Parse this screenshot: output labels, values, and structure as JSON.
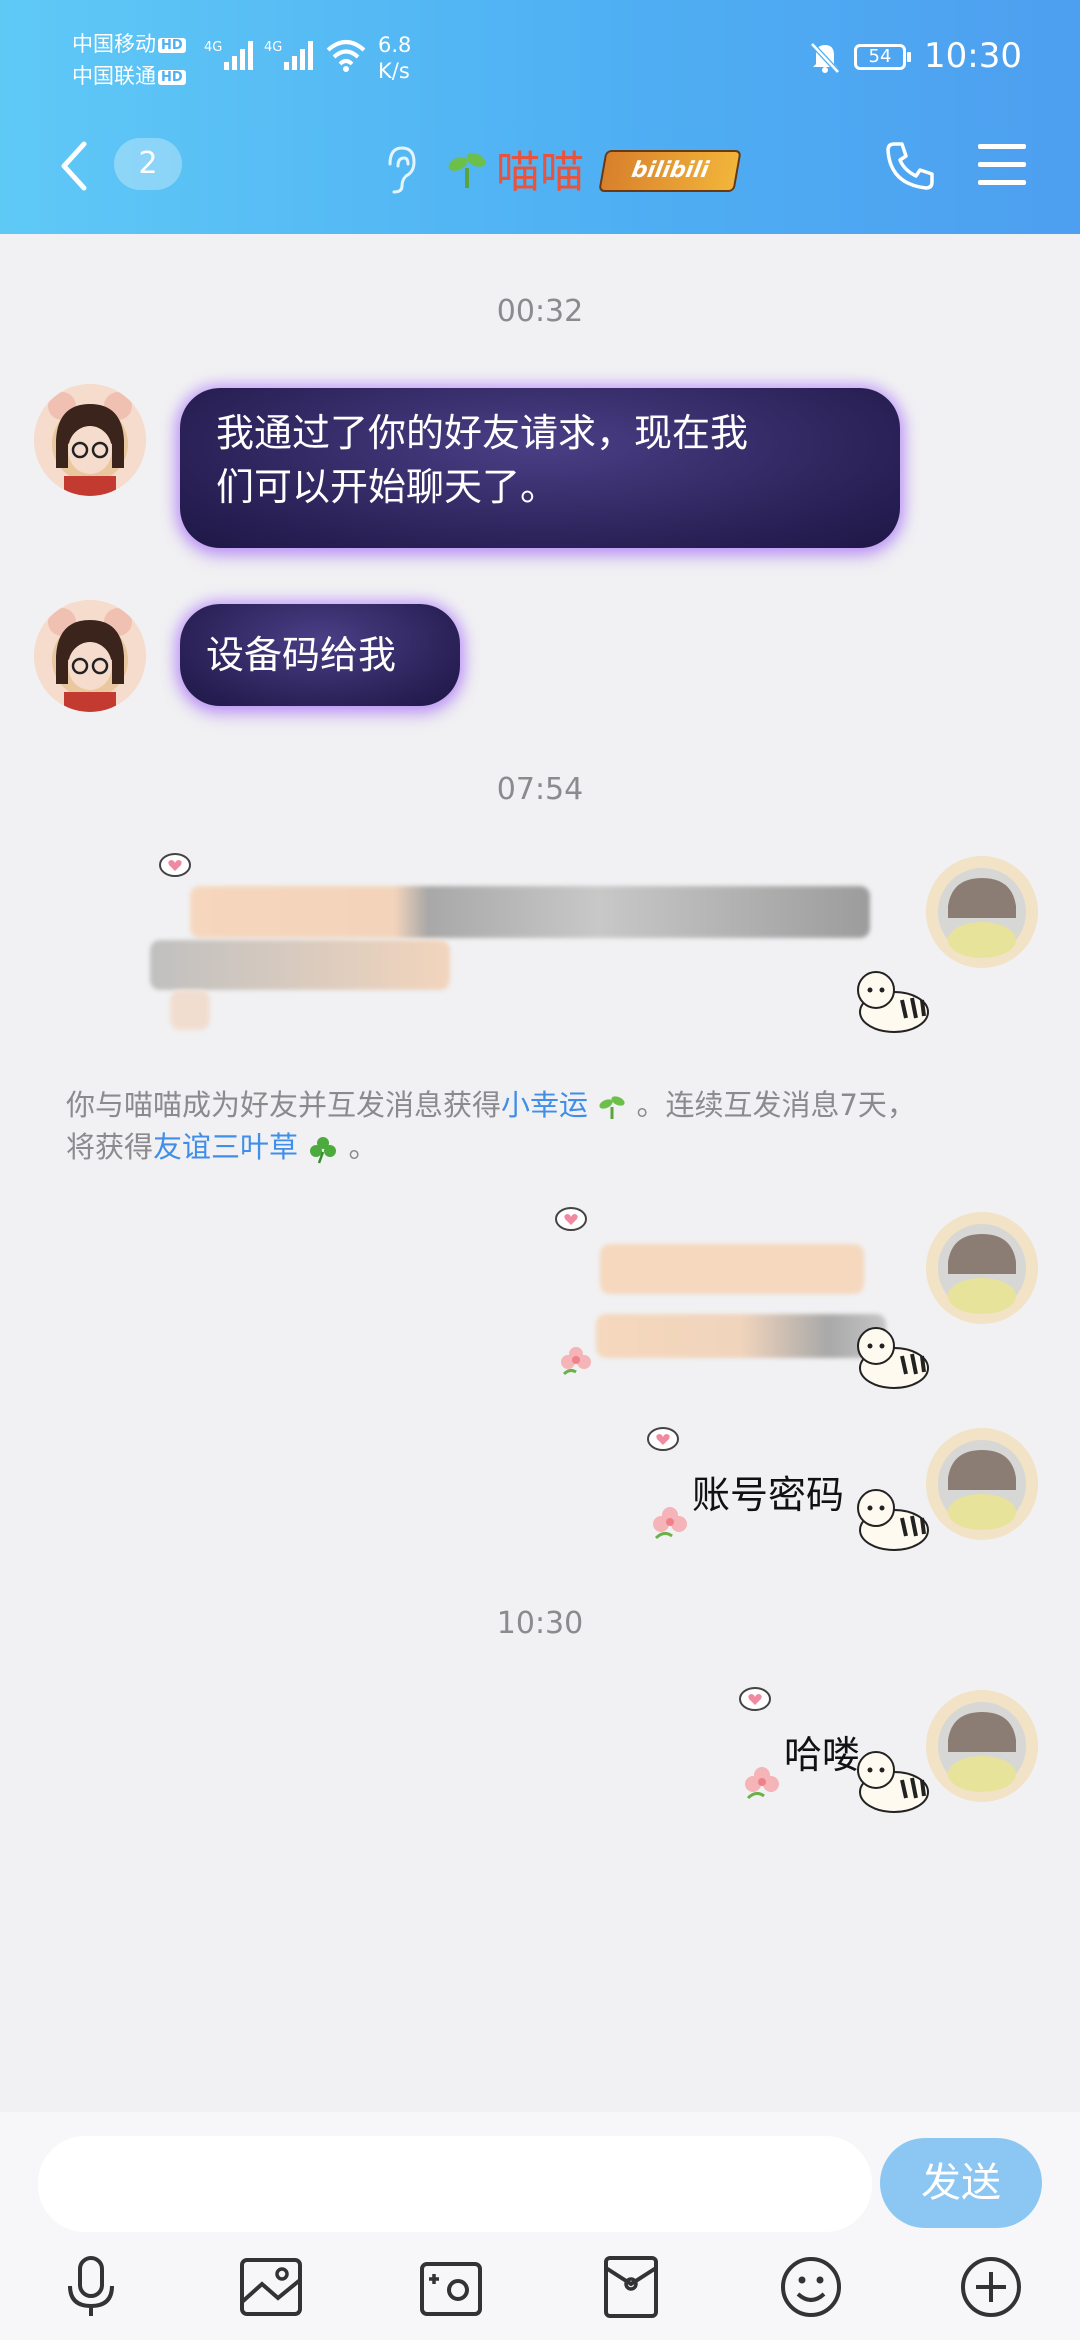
{
  "status_bar": {
    "carrier_1": "中国移动",
    "carrier_2": "中国联通",
    "hd_1": "HD",
    "hd_2": "HD",
    "network_1": "4G",
    "network_2": "4G",
    "speed_value": "6.8",
    "speed_unit": "K/s",
    "battery": "54",
    "time": "10:30"
  },
  "header": {
    "unread_count": "2",
    "contact_name": "喵喵",
    "badge_text": "bilibili",
    "accent_color": "#4fb0f3",
    "name_color": "#e8533d"
  },
  "messages": [
    {
      "timestamp": "00:32"
    },
    {
      "from": "contact",
      "text_line1": "我通过了你的好友请求，现在我",
      "text_line2": "们可以开始聊天了。"
    },
    {
      "from": "contact",
      "text": "设备码给我"
    },
    {
      "timestamp": "07:54"
    },
    {
      "from": "me",
      "text": ""
    },
    {
      "from": "me",
      "text": ""
    },
    {
      "from": "me",
      "text": "账号密码"
    },
    {
      "timestamp": "10:30"
    },
    {
      "from": "me",
      "text": "哈喽"
    }
  ],
  "system_message": {
    "part1": "你与喵喵成为好友并互发消息获得",
    "link1": "小幸运",
    "part2": "。连续互发消息7天，",
    "part3": "将获得",
    "link2": "友谊三叶草",
    "part4": "。"
  },
  "input": {
    "placeholder": "",
    "send_label": "发送"
  },
  "toolbar_icons": [
    "microphone-icon",
    "photo-icon",
    "camera-icon",
    "red-packet-icon",
    "emoji-icon",
    "plus-icon"
  ]
}
